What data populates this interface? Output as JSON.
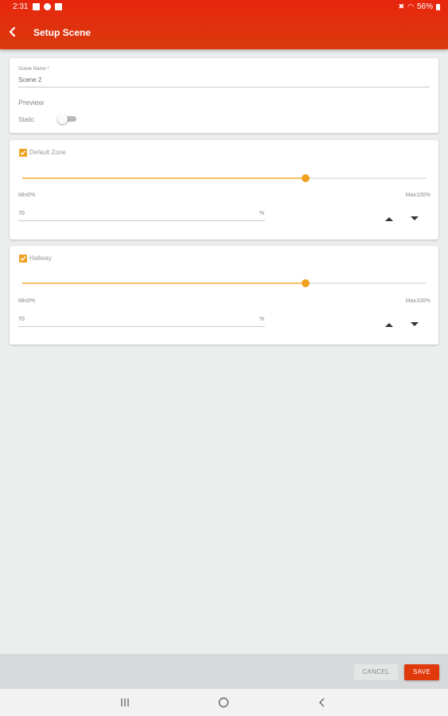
{
  "status": {
    "time": "2:31",
    "battery": "56%"
  },
  "header": {
    "title": "Setup Scene"
  },
  "scene": {
    "name_label": "Scene Name *",
    "name_value": "Scene 2",
    "preview_label": "Preview",
    "static_label": "Static",
    "preview_on": false
  },
  "zones": [
    {
      "name": "Default Zone",
      "checked": true,
      "level": 0.7,
      "min_label": "Min0%",
      "max_label": "Max100%",
      "value": "70",
      "unit": "%"
    },
    {
      "name": "Hallway",
      "checked": true,
      "level": 0.7,
      "min_label": "Min0%",
      "max_label": "Max100%",
      "value": "70",
      "unit": "%"
    }
  ],
  "footer": {
    "cancel_label": "CANCEL",
    "save_label": "SAVE"
  },
  "colors": {
    "accent": "#f0a020",
    "brand": "#e03a0c"
  },
  "icons": {
    "back": "arrow-back-icon",
    "up": "arrow-up-icon",
    "down": "arrow-down-icon"
  }
}
